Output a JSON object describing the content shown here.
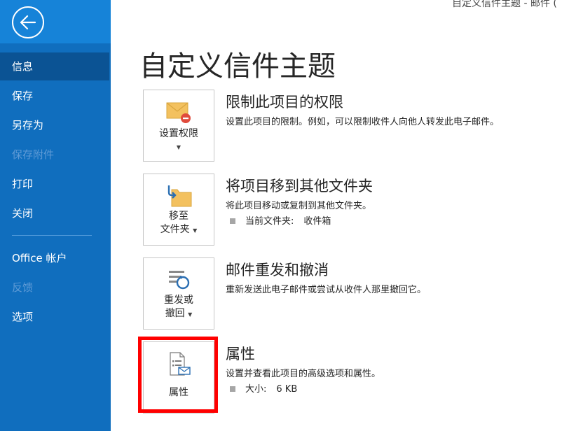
{
  "window": {
    "title": "自定义信件主题  -  邮件 ("
  },
  "sidebar": {
    "items": [
      {
        "label": "信息",
        "selected": true,
        "enabled": true
      },
      {
        "label": "保存",
        "selected": false,
        "enabled": true
      },
      {
        "label": "另存为",
        "selected": false,
        "enabled": true
      },
      {
        "label": "保存附件",
        "selected": false,
        "enabled": false
      },
      {
        "label": "打印",
        "selected": false,
        "enabled": true
      },
      {
        "label": "关闭",
        "selected": false,
        "enabled": true
      },
      {
        "label": "Office 帐户",
        "selected": false,
        "enabled": true
      },
      {
        "label": "反馈",
        "selected": false,
        "enabled": false
      },
      {
        "label": "选项",
        "selected": false,
        "enabled": true
      }
    ]
  },
  "main": {
    "title": "自定义信件主题",
    "sections": [
      {
        "button": {
          "line1": "设置权限",
          "line2": "",
          "icon": "envelope-restrict-icon"
        },
        "title": "限制此项目的权限",
        "description": "设置此项目的限制。例如，可以限制收件人向他人转发此电子邮件。"
      },
      {
        "button": {
          "line1": "移至",
          "line2": "文件夹",
          "icon": "move-to-folder-icon"
        },
        "title": "将项目移到其他文件夹",
        "description": "将此项目移动或复制到其他文件夹。",
        "property": {
          "key": "当前文件夹:",
          "value": "收件箱"
        }
      },
      {
        "button": {
          "line1": "重发或",
          "line2": "撤回",
          "icon": "resend-recall-icon"
        },
        "title": "邮件重发和撤消",
        "description": "重新发送此电子邮件或尝试从收件人那里撤回它。"
      },
      {
        "button": {
          "line1": "属性",
          "line2": "",
          "icon": "properties-icon"
        },
        "title": "属性",
        "description": "设置并查看此项目的高级选项和属性。",
        "property": {
          "key": "大小:",
          "value": "6 KB"
        }
      }
    ]
  },
  "colors": {
    "sidebar": "#106ebe",
    "sidebar_selected": "#0b5394",
    "highlight": "#ff0000"
  }
}
